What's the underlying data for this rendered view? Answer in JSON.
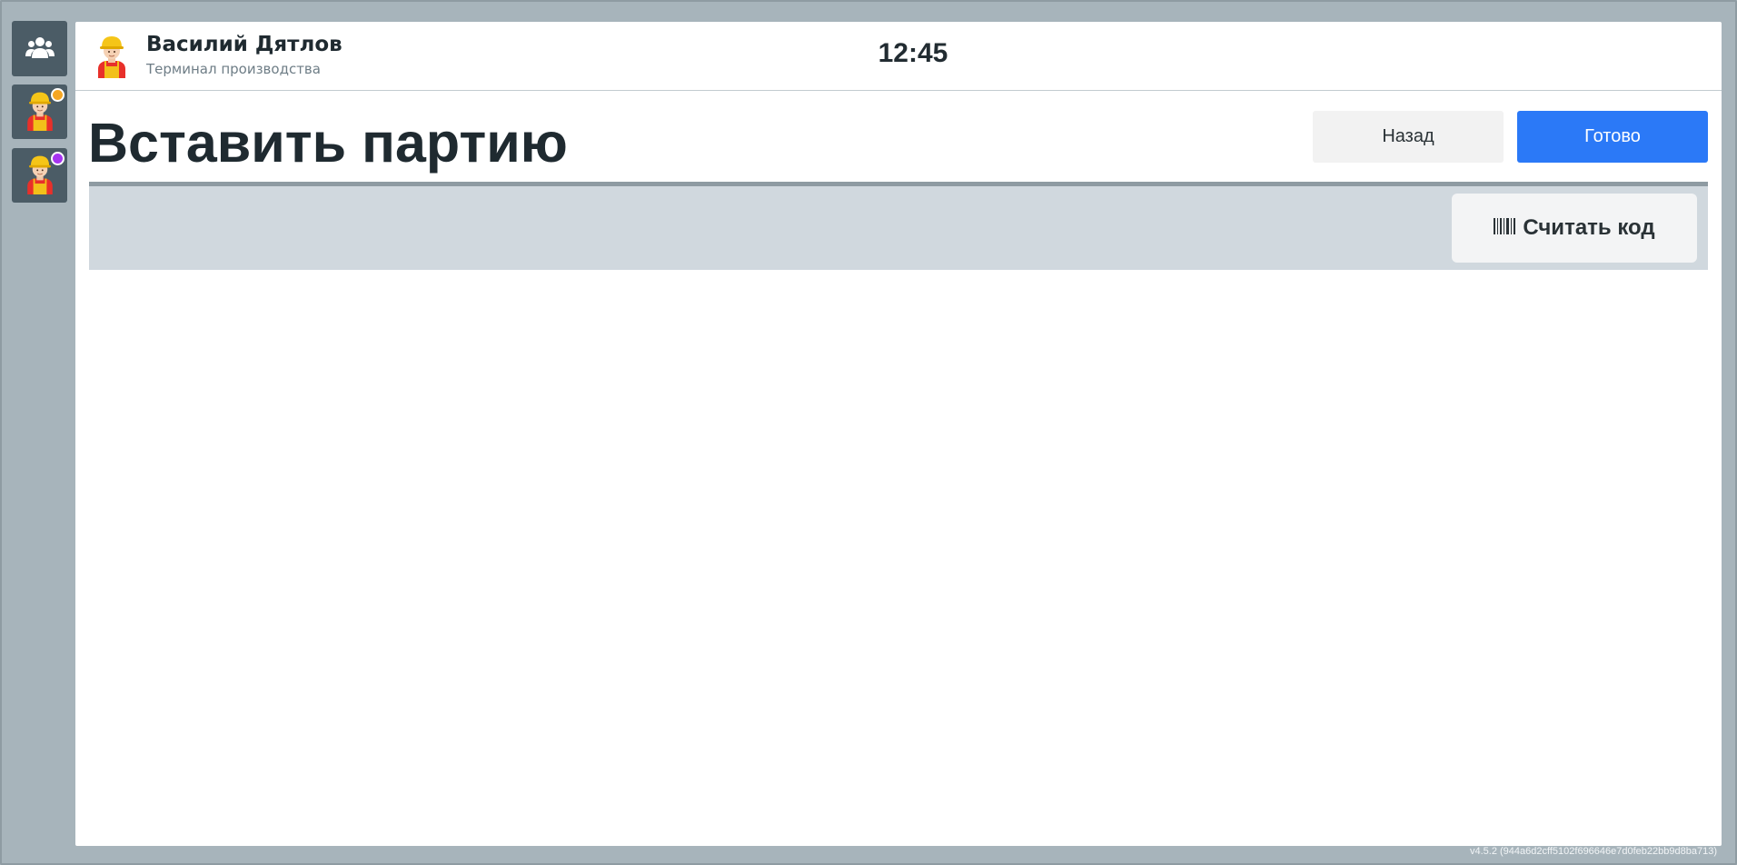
{
  "header": {
    "user_name": "Василий Дятлов",
    "user_role": "Терминал производства",
    "clock": "12:45"
  },
  "rail": {
    "items": [
      {
        "icon": "team-icon"
      },
      {
        "icon": "worker-avatar-icon",
        "status_color": "#f5a623"
      },
      {
        "icon": "worker-avatar-icon",
        "status_color": "#a634f0"
      }
    ]
  },
  "page": {
    "title": "Вставить партию",
    "back_label": "Назад",
    "done_label": "Готово",
    "scan_label": "Считать код"
  },
  "colors": {
    "accent": "#2b79f7",
    "rail_bg": "#4b5c66",
    "scanbar_bg": "#d0d8de"
  },
  "footer": {
    "version": "v4.5.2 (944a6d2cff5102f696646e7d0feb22bb9d8ba713)"
  }
}
